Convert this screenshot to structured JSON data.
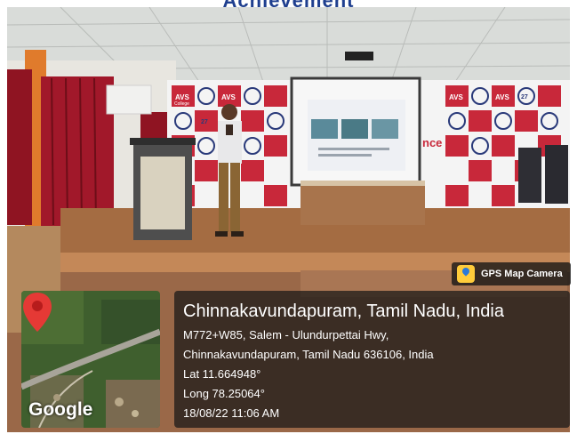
{
  "banner": {
    "title": "Achievement"
  },
  "badge": {
    "label": "GPS Map Camera"
  },
  "map": {
    "provider": "Google"
  },
  "location": {
    "place": "Chinnakavundapuram, Tamil Nadu, India",
    "address_line1": "M772+W85, Salem - Ulundurpettai Hwy,",
    "address_line2": "Chinnakavundapuram, Tamil Nadu 636106, India",
    "lat": "Lat 11.664948°",
    "long": "Long 78.25064°",
    "datetime": "18/08/22 11:06 AM"
  },
  "backdrop": {
    "brand_text": "AVS",
    "brand_sub": "College",
    "badge_number": "27",
    "partial_word": "nce"
  },
  "colors": {
    "banner": "#1f3f8f",
    "backdrop_red": "#c8283a",
    "curtain": "#8f1422",
    "pin": "#e53935"
  }
}
